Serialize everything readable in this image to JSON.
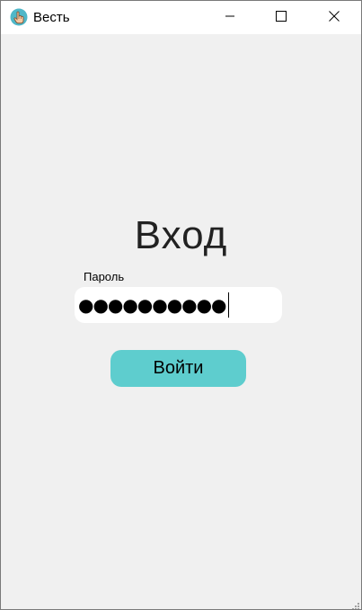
{
  "window": {
    "title": "Весть",
    "app_icon": "hand-pointer-icon",
    "controls": [
      "minimize-icon",
      "maximize-icon",
      "close-icon"
    ]
  },
  "login": {
    "heading": "Вход",
    "password_label": "Пароль",
    "password_masked": "●●●●●●●●●●",
    "submit_label": "Войти"
  },
  "colors": {
    "accent": "#5ecdce",
    "background": "#f0f0f0",
    "field_background": "#ffffff"
  }
}
